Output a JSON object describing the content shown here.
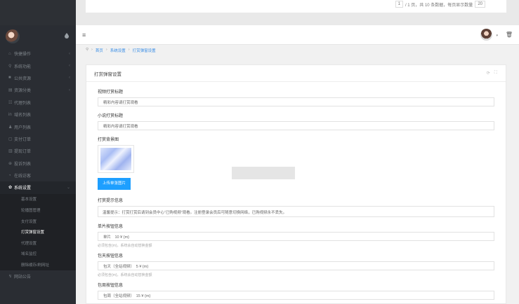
{
  "pager": {
    "page": "1",
    "text": "/ 1 页，共 10 条数据，每页显示数量",
    "size": "20"
  },
  "sidebar": {
    "items": [
      {
        "icon": "⌂",
        "label": "快捷操作",
        "chev": "‹"
      },
      {
        "icon": "⚲",
        "label": "系统功能",
        "chev": "‹"
      },
      {
        "icon": "■",
        "label": "公共资源",
        "chev": "‹"
      },
      {
        "icon": "▤",
        "label": "资源分类",
        "chev": "‹"
      },
      {
        "icon": "☷",
        "label": "代理列表",
        "chev": ""
      },
      {
        "icon": "in",
        "label": "域名列表",
        "chev": ""
      },
      {
        "icon": "♟",
        "label": "用户列表",
        "chev": ""
      },
      {
        "icon": "▢",
        "label": "支付订单",
        "chev": ""
      },
      {
        "icon": "▥",
        "label": "提现订单",
        "chev": ""
      },
      {
        "icon": "⊕",
        "label": "投诉列表",
        "chev": ""
      },
      {
        "icon": "◔",
        "label": "在线访客",
        "chev": ""
      },
      {
        "icon": "✿",
        "label": "系统设置",
        "chev": "⌄"
      }
    ],
    "subitems": [
      "基本设置",
      "轮播图管理",
      "支付设置",
      "打赏弹窗设置",
      "代理设置",
      "域名监控",
      "删除缓存/刷网址"
    ],
    "last_item": {
      "icon": "↯",
      "label": "网站公告"
    }
  },
  "breadcrumb": {
    "home_icon": "⚲",
    "items": [
      "首页",
      "系统设置",
      "打赏弹窗设置"
    ]
  },
  "card": {
    "title": "打赏弹窗设置",
    "tools": {
      "refresh": "⟳",
      "expand": "⛶"
    },
    "fields": [
      {
        "label": "视频打赏标题",
        "value": "精彩内容请打赏观看"
      },
      {
        "label": "小说打赏标题",
        "value": "精彩内容请打赏观看"
      }
    ],
    "bg_label": "打赏背景图",
    "upload_label": "上传单张图片",
    "notice_label": "打赏提示信息",
    "notice_value": "温馨提示：打赏打赏后请到会员中心“已购视频”观看。注册登录会员后可随意切换网络，已购视频永不丢失。",
    "single": {
      "label": "单片按钮信息",
      "value": "单片　10 ¥ {m}",
      "hint": "必须包含{m}，系统会自动替换金额"
    },
    "day": {
      "label": "包天按钮信息",
      "value": "包天（全站视频）　5 ¥ {m}",
      "hint": "必须包含{m}，系统会自动替换金额"
    },
    "week": {
      "label": "包周按钮信息",
      "value": "包周（全站视频）　15 ¥ {m}"
    }
  }
}
